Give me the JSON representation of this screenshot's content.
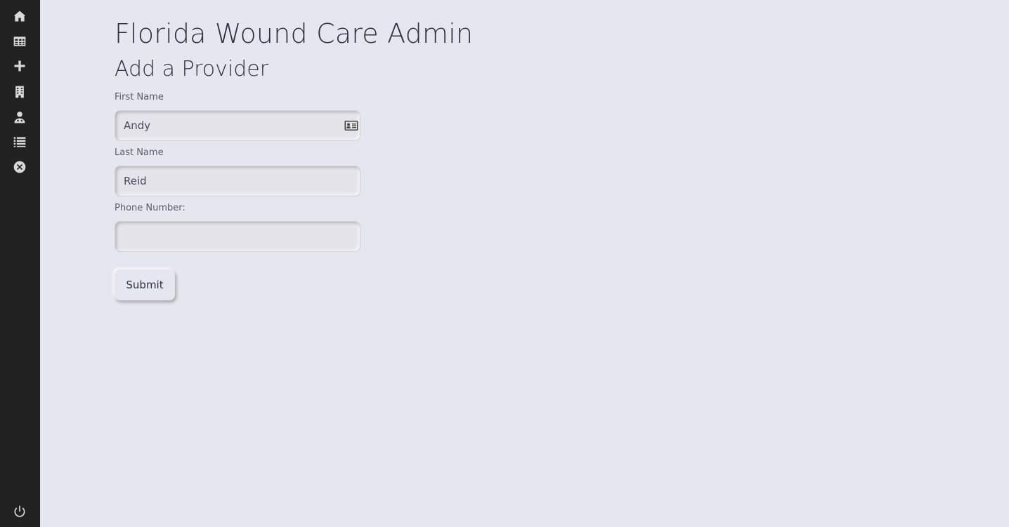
{
  "sidebar": {
    "items": [
      {
        "name": "home-icon"
      },
      {
        "name": "table-icon"
      },
      {
        "name": "plus-icon"
      },
      {
        "name": "building-icon"
      },
      {
        "name": "user-doctor-icon"
      },
      {
        "name": "list-icon"
      },
      {
        "name": "close-circle-icon"
      }
    ],
    "footer": {
      "name": "power-icon"
    }
  },
  "header": {
    "title": "Florida Wound Care Admin",
    "subtitle": "Add a Provider"
  },
  "form": {
    "first_name": {
      "label": "First Name",
      "value": "Andy"
    },
    "last_name": {
      "label": "Last Name",
      "value": "Reid"
    },
    "phone": {
      "label": "Phone Number:",
      "value": ""
    },
    "submit_label": "Submit"
  },
  "colors": {
    "sidebar_bg": "#212121",
    "page_bg": "#e6e6ee",
    "text": "#2f2f44"
  }
}
